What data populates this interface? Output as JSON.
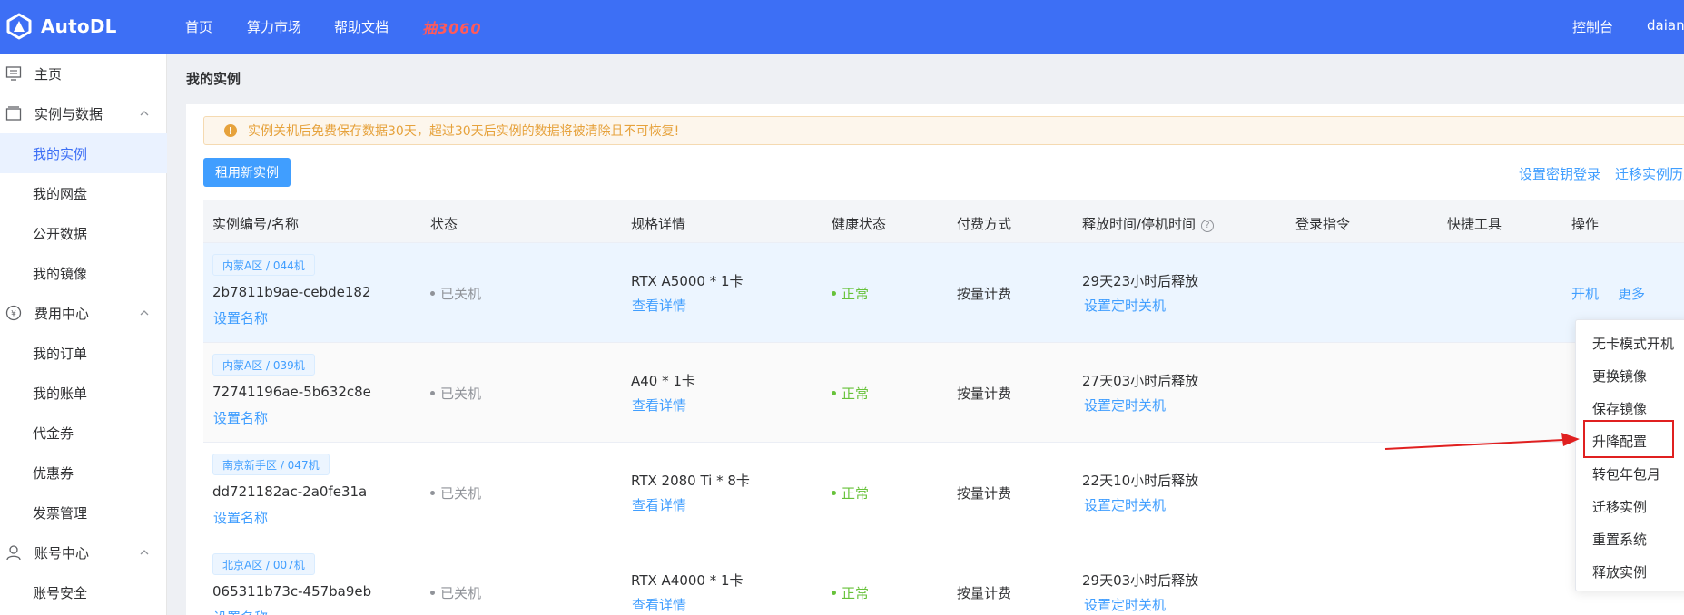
{
  "header": {
    "logo": "AutoDL",
    "nav": [
      "首页",
      "算力市场",
      "帮助文档"
    ],
    "promo": "抽3060",
    "console": "控制台",
    "user": "daianb"
  },
  "sidebar": {
    "home": "主页",
    "group_instances": "实例与数据",
    "instances_items": [
      "我的实例",
      "我的网盘",
      "公开数据",
      "我的镜像"
    ],
    "group_fees": "费用中心",
    "fees_items": [
      "我的订单",
      "我的账单",
      "代金券",
      "优惠券",
      "发票管理"
    ],
    "group_account": "账号中心",
    "account_items": [
      "账号安全"
    ]
  },
  "main": {
    "title": "我的实例",
    "alert": "实例关机后免费保存数据30天，超过30天后实例的数据将被清除且不可恢复!",
    "rent_button": "租用新实例",
    "link_key_login": "设置密钥登录",
    "link_migrate_history": "迁移实例历史",
    "columns": [
      "实例编号/名称",
      "状态",
      "规格详情",
      "健康状态",
      "付费方式",
      "释放时间/停机时间",
      "登录指令",
      "快捷工具",
      "操作"
    ],
    "rows": [
      {
        "tag": "内蒙A区 / 044机",
        "id": "2b7811b9ae-cebde182",
        "set_name": "设置名称",
        "status": "已关机",
        "spec": "RTX A5000 * 1卡",
        "detail": "查看详情",
        "health": "正常",
        "pay": "按量计费",
        "release": "29天23小时后释放",
        "timer": "设置定时关机",
        "op_start": "开机",
        "op_more": "更多"
      },
      {
        "tag": "内蒙A区 / 039机",
        "id": "72741196ae-5b632c8e",
        "set_name": "设置名称",
        "status": "已关机",
        "spec": "A40 * 1卡",
        "detail": "查看详情",
        "health": "正常",
        "pay": "按量计费",
        "release": "27天03小时后释放",
        "timer": "设置定时关机"
      },
      {
        "tag": "南京新手区 / 047机",
        "id": "dd721182ac-2a0fe31a",
        "set_name": "设置名称",
        "status": "已关机",
        "spec": "RTX 2080 Ti * 8卡",
        "detail": "查看详情",
        "health": "正常",
        "pay": "按量计费",
        "release": "22天10小时后释放",
        "timer": "设置定时关机"
      },
      {
        "tag": "北京A区 / 007机",
        "id": "065311b73c-457ba9eb",
        "set_name": "设置名称",
        "status": "已关机",
        "spec": "RTX A4000 * 1卡",
        "detail": "查看详情",
        "health": "正常",
        "pay": "按量计费",
        "release": "29天03小时后释放",
        "timer": "设置定时关机"
      }
    ],
    "dropdown": [
      "无卡模式开机",
      "更换镜像",
      "保存镜像",
      "升降配置",
      "转包年包月",
      "迁移实例",
      "重置系统",
      "释放实例"
    ]
  },
  "colors": {
    "header": "#3d6ff5",
    "link": "#409eff",
    "ok": "#67c23a",
    "warn": "#e6a23c",
    "annotation": "#e02020"
  }
}
